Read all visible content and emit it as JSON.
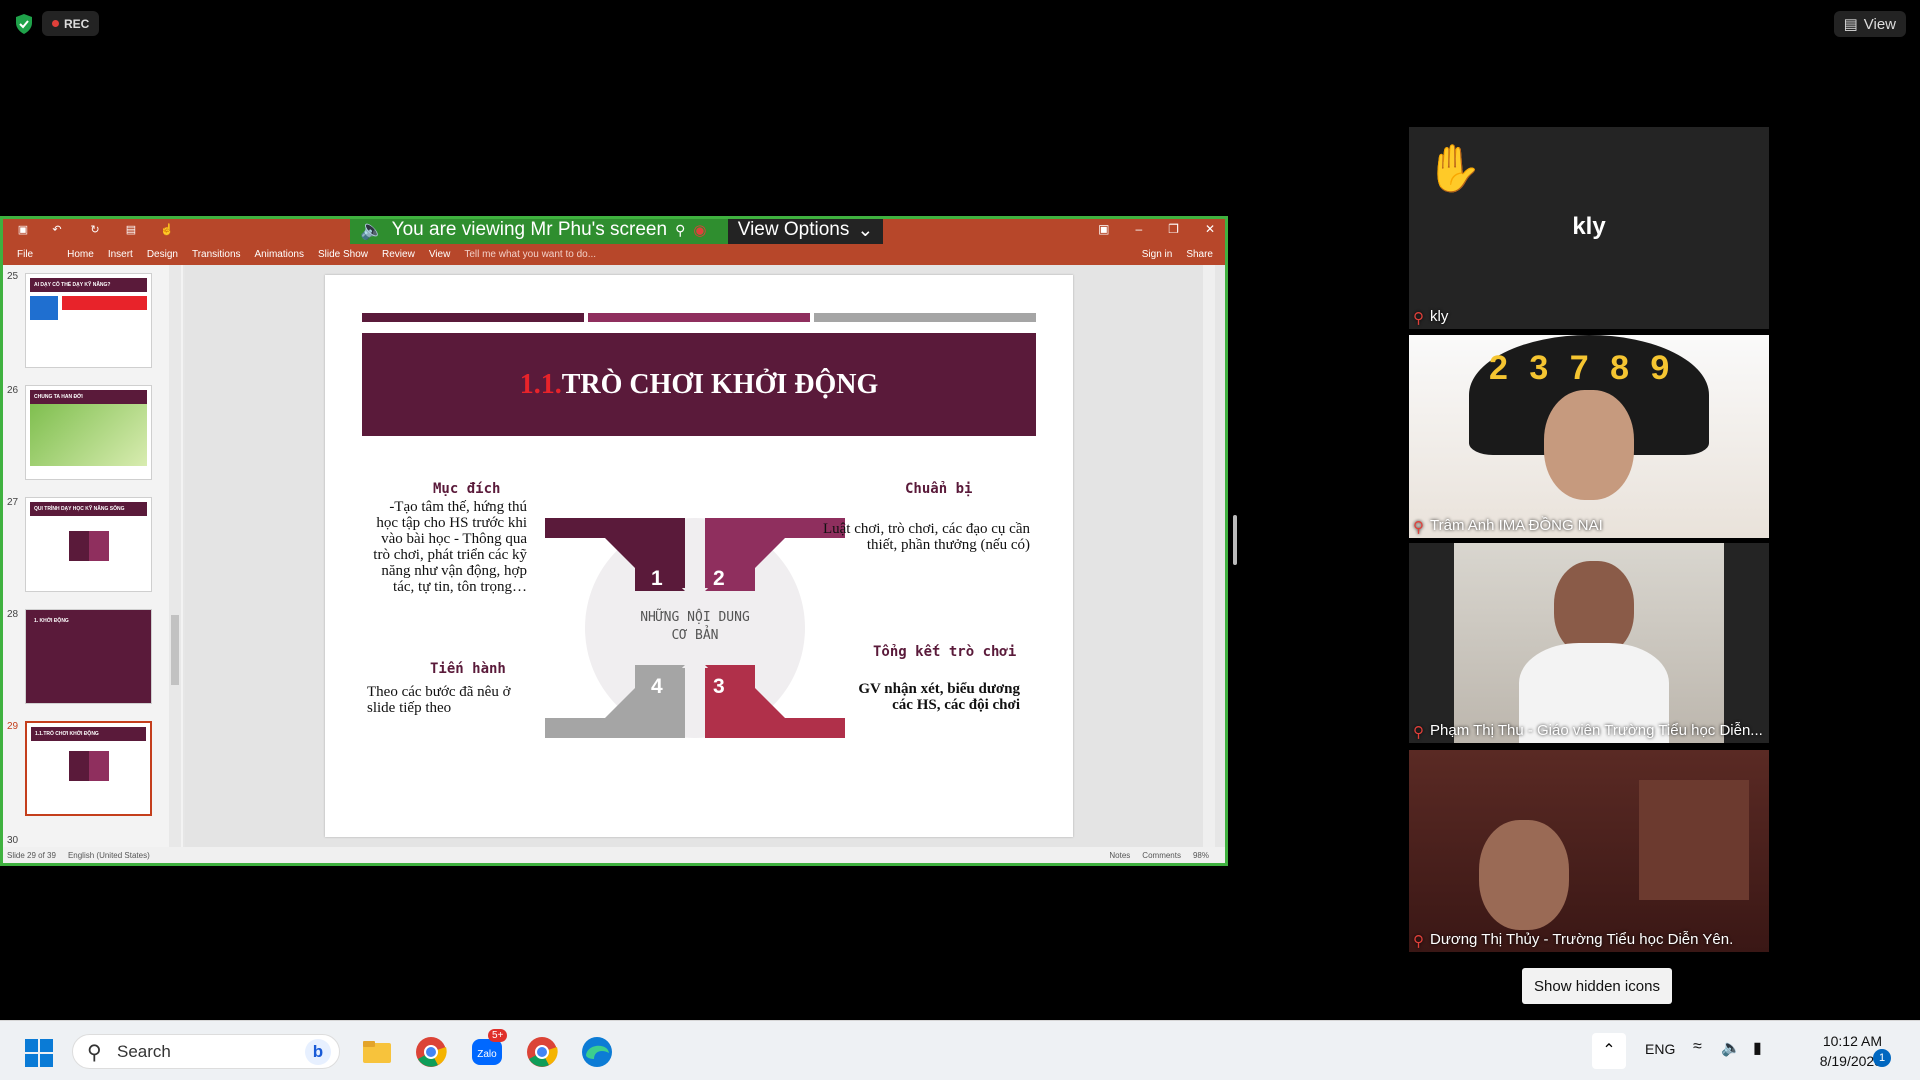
{
  "zoom": {
    "rec_label": "REC",
    "view_label": "View",
    "viewing_banner": "You are viewing Mr Phu's screen",
    "view_options": "View Options"
  },
  "ppt": {
    "menu": [
      "File",
      "Home",
      "Insert",
      "Design",
      "Transitions",
      "Animations",
      "Slide Show",
      "Review",
      "View"
    ],
    "tell_me": "Tell me what you want to do...",
    "sign_in": "Sign in",
    "share": "Share",
    "status_slide": "Slide 29 of 39",
    "status_lang": "English (United States)",
    "status_notes": "Notes",
    "status_comments": "Comments",
    "status_zoom": "98%",
    "thumbnails": [
      {
        "num": "25",
        "title": "AI DẠY CÔ THỂ DẠY KỸ NĂNG?"
      },
      {
        "num": "26",
        "title": "CHUNG TA HAN ĐỞI"
      },
      {
        "num": "27",
        "title": "QUI TRÌNH DẠY HỌC KỸ NĂNG SỐNG"
      },
      {
        "num": "28",
        "title": "1. KHỞI ĐỘNG"
      },
      {
        "num": "29",
        "title": "1.1.TRÒ CHƠI KHỞI ĐỘNG"
      },
      {
        "num": "30",
        "title": ""
      }
    ],
    "slide": {
      "title_num": "1.1.",
      "title_text": "TRÒ CHƠI KHỞI ĐỘNG",
      "center_line1": "NHỮNG NỘI DUNG",
      "center_line2": "CƠ BẢN",
      "arrows": [
        "1",
        "2",
        "3",
        "4"
      ],
      "muc_dich_head": "Mục đích",
      "muc_dich_text": "-Tạo tâm thế, hứng thú học tập cho HS trước khi vào bài học - Thông qua trò chơi, phát triển các kỹ năng như vận động, hợp tác, tự tin, tôn trọng…",
      "chuan_bi_head": "Chuẩn bị",
      "chuan_bi_text": "Luật chơi, trò chơi, các đạo cụ cần thiết, phần thưởng (nếu có)",
      "tien_hanh_head": "Tiến hành",
      "tien_hanh_text": "Theo các bước đã nêu ở slide tiếp theo",
      "tong_ket_head": "Tổng kết trò chơi",
      "tong_ket_text": "GV nhận xét, biểu dương các HS, các đội chơi"
    }
  },
  "participants": [
    {
      "name": "kly",
      "display": "kly"
    },
    {
      "name": "Trâm Anh IMA ĐỒNG NAI"
    },
    {
      "name": "Phạm Thị Thu - Giáo viên Trường Tiểu học Diễn..."
    },
    {
      "name": "Dương Thị Thủy - Trường Tiểu học Diễn Yên."
    }
  ],
  "show_hidden": "Show hidden icons",
  "taskbar": {
    "search": "Search",
    "lang": "ENG",
    "time": "10:12 AM",
    "date": "8/19/2023",
    "zalo_badge": "5+",
    "notif_count": "1"
  },
  "colors": {
    "accent_green": "#3fb13f",
    "ppt_red": "#b7472a",
    "slide_maroon": "#5a1a3a",
    "arrow_magenta": "#8f2f5e",
    "arrow_red": "#b0304a",
    "arrow_grey": "#a5a5a5"
  }
}
